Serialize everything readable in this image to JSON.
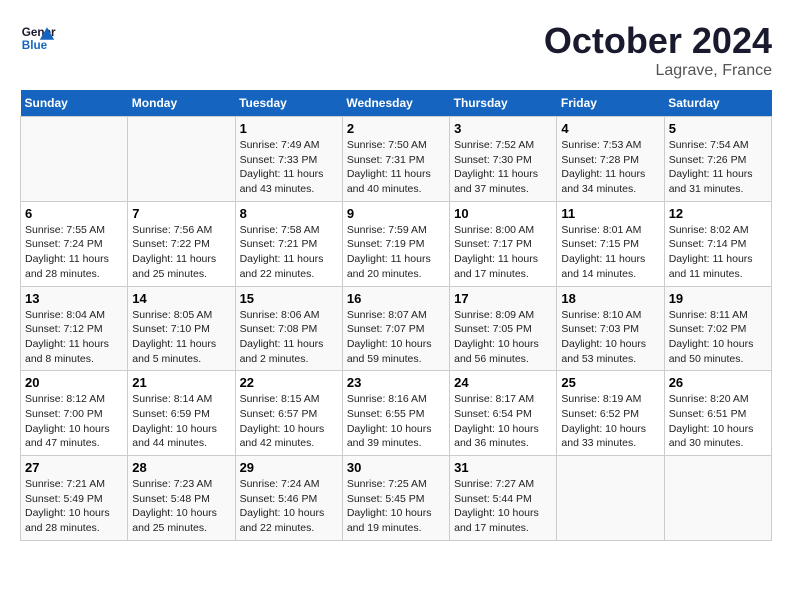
{
  "header": {
    "logo_general": "General",
    "logo_blue": "Blue",
    "month_title": "October 2024",
    "location": "Lagrave, France"
  },
  "weekdays": [
    "Sunday",
    "Monday",
    "Tuesday",
    "Wednesday",
    "Thursday",
    "Friday",
    "Saturday"
  ],
  "weeks": [
    [
      {
        "day": "",
        "sunrise": "",
        "sunset": "",
        "daylight": ""
      },
      {
        "day": "",
        "sunrise": "",
        "sunset": "",
        "daylight": ""
      },
      {
        "day": "1",
        "sunrise": "Sunrise: 7:49 AM",
        "sunset": "Sunset: 7:33 PM",
        "daylight": "Daylight: 11 hours and 43 minutes."
      },
      {
        "day": "2",
        "sunrise": "Sunrise: 7:50 AM",
        "sunset": "Sunset: 7:31 PM",
        "daylight": "Daylight: 11 hours and 40 minutes."
      },
      {
        "day": "3",
        "sunrise": "Sunrise: 7:52 AM",
        "sunset": "Sunset: 7:30 PM",
        "daylight": "Daylight: 11 hours and 37 minutes."
      },
      {
        "day": "4",
        "sunrise": "Sunrise: 7:53 AM",
        "sunset": "Sunset: 7:28 PM",
        "daylight": "Daylight: 11 hours and 34 minutes."
      },
      {
        "day": "5",
        "sunrise": "Sunrise: 7:54 AM",
        "sunset": "Sunset: 7:26 PM",
        "daylight": "Daylight: 11 hours and 31 minutes."
      }
    ],
    [
      {
        "day": "6",
        "sunrise": "Sunrise: 7:55 AM",
        "sunset": "Sunset: 7:24 PM",
        "daylight": "Daylight: 11 hours and 28 minutes."
      },
      {
        "day": "7",
        "sunrise": "Sunrise: 7:56 AM",
        "sunset": "Sunset: 7:22 PM",
        "daylight": "Daylight: 11 hours and 25 minutes."
      },
      {
        "day": "8",
        "sunrise": "Sunrise: 7:58 AM",
        "sunset": "Sunset: 7:21 PM",
        "daylight": "Daylight: 11 hours and 22 minutes."
      },
      {
        "day": "9",
        "sunrise": "Sunrise: 7:59 AM",
        "sunset": "Sunset: 7:19 PM",
        "daylight": "Daylight: 11 hours and 20 minutes."
      },
      {
        "day": "10",
        "sunrise": "Sunrise: 8:00 AM",
        "sunset": "Sunset: 7:17 PM",
        "daylight": "Daylight: 11 hours and 17 minutes."
      },
      {
        "day": "11",
        "sunrise": "Sunrise: 8:01 AM",
        "sunset": "Sunset: 7:15 PM",
        "daylight": "Daylight: 11 hours and 14 minutes."
      },
      {
        "day": "12",
        "sunrise": "Sunrise: 8:02 AM",
        "sunset": "Sunset: 7:14 PM",
        "daylight": "Daylight: 11 hours and 11 minutes."
      }
    ],
    [
      {
        "day": "13",
        "sunrise": "Sunrise: 8:04 AM",
        "sunset": "Sunset: 7:12 PM",
        "daylight": "Daylight: 11 hours and 8 minutes."
      },
      {
        "day": "14",
        "sunrise": "Sunrise: 8:05 AM",
        "sunset": "Sunset: 7:10 PM",
        "daylight": "Daylight: 11 hours and 5 minutes."
      },
      {
        "day": "15",
        "sunrise": "Sunrise: 8:06 AM",
        "sunset": "Sunset: 7:08 PM",
        "daylight": "Daylight: 11 hours and 2 minutes."
      },
      {
        "day": "16",
        "sunrise": "Sunrise: 8:07 AM",
        "sunset": "Sunset: 7:07 PM",
        "daylight": "Daylight: 10 hours and 59 minutes."
      },
      {
        "day": "17",
        "sunrise": "Sunrise: 8:09 AM",
        "sunset": "Sunset: 7:05 PM",
        "daylight": "Daylight: 10 hours and 56 minutes."
      },
      {
        "day": "18",
        "sunrise": "Sunrise: 8:10 AM",
        "sunset": "Sunset: 7:03 PM",
        "daylight": "Daylight: 10 hours and 53 minutes."
      },
      {
        "day": "19",
        "sunrise": "Sunrise: 8:11 AM",
        "sunset": "Sunset: 7:02 PM",
        "daylight": "Daylight: 10 hours and 50 minutes."
      }
    ],
    [
      {
        "day": "20",
        "sunrise": "Sunrise: 8:12 AM",
        "sunset": "Sunset: 7:00 PM",
        "daylight": "Daylight: 10 hours and 47 minutes."
      },
      {
        "day": "21",
        "sunrise": "Sunrise: 8:14 AM",
        "sunset": "Sunset: 6:59 PM",
        "daylight": "Daylight: 10 hours and 44 minutes."
      },
      {
        "day": "22",
        "sunrise": "Sunrise: 8:15 AM",
        "sunset": "Sunset: 6:57 PM",
        "daylight": "Daylight: 10 hours and 42 minutes."
      },
      {
        "day": "23",
        "sunrise": "Sunrise: 8:16 AM",
        "sunset": "Sunset: 6:55 PM",
        "daylight": "Daylight: 10 hours and 39 minutes."
      },
      {
        "day": "24",
        "sunrise": "Sunrise: 8:17 AM",
        "sunset": "Sunset: 6:54 PM",
        "daylight": "Daylight: 10 hours and 36 minutes."
      },
      {
        "day": "25",
        "sunrise": "Sunrise: 8:19 AM",
        "sunset": "Sunset: 6:52 PM",
        "daylight": "Daylight: 10 hours and 33 minutes."
      },
      {
        "day": "26",
        "sunrise": "Sunrise: 8:20 AM",
        "sunset": "Sunset: 6:51 PM",
        "daylight": "Daylight: 10 hours and 30 minutes."
      }
    ],
    [
      {
        "day": "27",
        "sunrise": "Sunrise: 7:21 AM",
        "sunset": "Sunset: 5:49 PM",
        "daylight": "Daylight: 10 hours and 28 minutes."
      },
      {
        "day": "28",
        "sunrise": "Sunrise: 7:23 AM",
        "sunset": "Sunset: 5:48 PM",
        "daylight": "Daylight: 10 hours and 25 minutes."
      },
      {
        "day": "29",
        "sunrise": "Sunrise: 7:24 AM",
        "sunset": "Sunset: 5:46 PM",
        "daylight": "Daylight: 10 hours and 22 minutes."
      },
      {
        "day": "30",
        "sunrise": "Sunrise: 7:25 AM",
        "sunset": "Sunset: 5:45 PM",
        "daylight": "Daylight: 10 hours and 19 minutes."
      },
      {
        "day": "31",
        "sunrise": "Sunrise: 7:27 AM",
        "sunset": "Sunset: 5:44 PM",
        "daylight": "Daylight: 10 hours and 17 minutes."
      },
      {
        "day": "",
        "sunrise": "",
        "sunset": "",
        "daylight": ""
      },
      {
        "day": "",
        "sunrise": "",
        "sunset": "",
        "daylight": ""
      }
    ]
  ]
}
